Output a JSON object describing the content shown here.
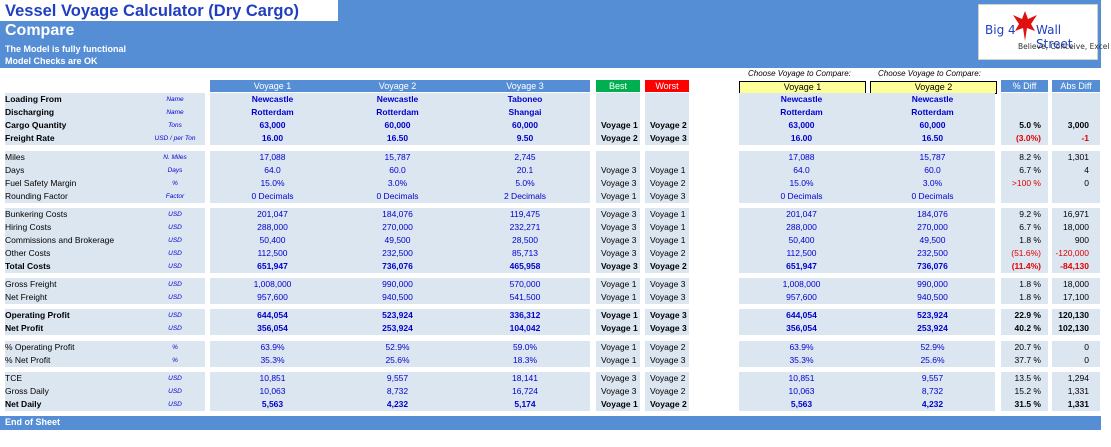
{
  "title": "Vessel Voyage Calculator (Dry Cargo)",
  "subtitle": "Compare",
  "status": [
    "The Model is fully functional",
    "Model Checks are OK"
  ],
  "logo": {
    "left": "Big 4",
    "right": "Wall Street",
    "tagline": "Believe, Conceive, Excel",
    "icon": "eagle-icon"
  },
  "footer": "End of Sheet",
  "colors": {
    "band": "#558ed5",
    "value_blue": "#0000cc",
    "row_shade": "#dce6f1",
    "best": "#00b050",
    "worst": "#ff0000",
    "negative": "#e00000",
    "select": "#ffff99"
  },
  "headers": {
    "voyages": [
      "Voyage 1",
      "Voyage 2",
      "Voyage 3"
    ],
    "best": "Best",
    "worst": "Worst",
    "choose": [
      "Choose Voyage to Compare:",
      "Choose Voyage to Compare:"
    ],
    "selected": [
      "Voyage 1",
      "Voyage 2"
    ],
    "pct_diff": "% Diff",
    "abs_diff": "Abs Diff"
  },
  "rows": [
    {
      "label": "Loading From",
      "bold": true,
      "unit": "Name",
      "v": [
        "Newcastle",
        "Newcastle",
        "Taboneo"
      ],
      "best": "",
      "worst": "",
      "c": [
        "Newcastle",
        "Newcastle"
      ],
      "pd": "",
      "ad": ""
    },
    {
      "label": "Discharging",
      "bold": true,
      "unit": "Name",
      "v": [
        "Rotterdam",
        "Rotterdam",
        "Shangai"
      ],
      "best": "",
      "worst": "",
      "c": [
        "Rotterdam",
        "Rotterdam"
      ],
      "pd": "",
      "ad": ""
    },
    {
      "label": "Cargo Quantity",
      "bold": true,
      "unit": "Tons",
      "v": [
        "63,000",
        "60,000",
        "60,000"
      ],
      "best": "Voyage 1",
      "worst": "Voyage 2",
      "c": [
        "63,000",
        "60,000"
      ],
      "pd": "5.0 %",
      "ad": "3,000"
    },
    {
      "label": "Freight Rate",
      "bold": true,
      "unit": "USD / per Ton",
      "v": [
        "16.00",
        "16.50",
        "9.50"
      ],
      "best": "Voyage 2",
      "worst": "Voyage 3",
      "c": [
        "16.00",
        "16.50"
      ],
      "pd": "(3.0%)",
      "ad": "-1",
      "neg": true
    },
    {
      "label": "Miles",
      "bold": false,
      "unit": "N. Miles",
      "v": [
        "17,088",
        "15,787",
        "2,745"
      ],
      "best": "",
      "worst": "",
      "c": [
        "17,088",
        "15,787"
      ],
      "pd": "8.2 %",
      "ad": "1,301"
    },
    {
      "label": "Days",
      "bold": false,
      "unit": "Days",
      "v": [
        "64.0",
        "60.0",
        "20.1"
      ],
      "best": "Voyage 3",
      "worst": "Voyage 1",
      "c": [
        "64.0",
        "60.0"
      ],
      "pd": "6.7 %",
      "ad": "4"
    },
    {
      "label": "Fuel Safety Margin",
      "bold": false,
      "unit": "%",
      "v": [
        "15.0%",
        "3.0%",
        "5.0%"
      ],
      "best": "Voyage 3",
      "worst": "Voyage 2",
      "c": [
        "15.0%",
        "3.0%"
      ],
      "pd": ">100 %",
      "ad": "0",
      "pdneg": true
    },
    {
      "label": "Rounding Factor",
      "bold": false,
      "unit": "Factor",
      "v": [
        "0 Decimals",
        "0 Decimals",
        "2 Decimals"
      ],
      "best": "Voyage 1",
      "worst": "Voyage 3",
      "c": [
        "0 Decimals",
        "0 Decimals"
      ],
      "pd": "",
      "ad": ""
    },
    {
      "label": "Bunkering Costs",
      "bold": false,
      "unit": "USD",
      "v": [
        "201,047",
        "184,076",
        "119,475"
      ],
      "best": "Voyage 3",
      "worst": "Voyage 1",
      "c": [
        "201,047",
        "184,076"
      ],
      "pd": "9.2 %",
      "ad": "16,971"
    },
    {
      "label": "Hiring Costs",
      "bold": false,
      "unit": "USD",
      "v": [
        "288,000",
        "270,000",
        "232,271"
      ],
      "best": "Voyage 3",
      "worst": "Voyage 1",
      "c": [
        "288,000",
        "270,000"
      ],
      "pd": "6.7 %",
      "ad": "18,000"
    },
    {
      "label": "Commissions and Brokerage",
      "bold": false,
      "unit": "USD",
      "v": [
        "50,400",
        "49,500",
        "28,500"
      ],
      "best": "Voyage 3",
      "worst": "Voyage 1",
      "c": [
        "50,400",
        "49,500"
      ],
      "pd": "1.8 %",
      "ad": "900"
    },
    {
      "label": "Other Costs",
      "bold": false,
      "unit": "USD",
      "v": [
        "112,500",
        "232,500",
        "85,713"
      ],
      "best": "Voyage 3",
      "worst": "Voyage 2",
      "c": [
        "112,500",
        "232,500"
      ],
      "pd": "(51.6%)",
      "ad": "-120,000",
      "neg": true
    },
    {
      "label": "Total Costs",
      "bold": true,
      "unit": "USD",
      "v": [
        "651,947",
        "736,076",
        "465,958"
      ],
      "best": "Voyage 3",
      "worst": "Voyage 2",
      "c": [
        "651,947",
        "736,076"
      ],
      "pd": "(11.4%)",
      "ad": "-84,130",
      "neg": true
    },
    {
      "label": "Gross Freight",
      "bold": false,
      "unit": "USD",
      "v": [
        "1,008,000",
        "990,000",
        "570,000"
      ],
      "best": "Voyage 1",
      "worst": "Voyage 3",
      "c": [
        "1,008,000",
        "990,000"
      ],
      "pd": "1.8 %",
      "ad": "18,000"
    },
    {
      "label": "Net Freight",
      "bold": false,
      "unit": "USD",
      "v": [
        "957,600",
        "940,500",
        "541,500"
      ],
      "best": "Voyage 1",
      "worst": "Voyage 3",
      "c": [
        "957,600",
        "940,500"
      ],
      "pd": "1.8 %",
      "ad": "17,100"
    },
    {
      "label": "Operating Profit",
      "bold": true,
      "unit": "USD",
      "v": [
        "644,054",
        "523,924",
        "336,312"
      ],
      "best": "Voyage 1",
      "worst": "Voyage 3",
      "c": [
        "644,054",
        "523,924"
      ],
      "pd": "22.9 %",
      "ad": "120,130"
    },
    {
      "label": "Net Profit",
      "bold": true,
      "unit": "USD",
      "v": [
        "356,054",
        "253,924",
        "104,042"
      ],
      "best": "Voyage 1",
      "worst": "Voyage 3",
      "c": [
        "356,054",
        "253,924"
      ],
      "pd": "40.2 %",
      "ad": "102,130"
    },
    {
      "label": "% Operating Profit",
      "bold": false,
      "unit": "%",
      "v": [
        "63.9%",
        "52.9%",
        "59.0%"
      ],
      "best": "Voyage 1",
      "worst": "Voyage 2",
      "c": [
        "63.9%",
        "52.9%"
      ],
      "pd": "20.7 %",
      "ad": "0"
    },
    {
      "label": "% Net Profit",
      "bold": false,
      "unit": "%",
      "v": [
        "35.3%",
        "25.6%",
        "18.3%"
      ],
      "best": "Voyage 1",
      "worst": "Voyage 3",
      "c": [
        "35.3%",
        "25.6%"
      ],
      "pd": "37.7 %",
      "ad": "0"
    },
    {
      "label": "TCE",
      "bold": false,
      "unit": "USD",
      "v": [
        "10,851",
        "9,557",
        "18,141"
      ],
      "best": "Voyage 3",
      "worst": "Voyage 2",
      "c": [
        "10,851",
        "9,557"
      ],
      "pd": "13.5 %",
      "ad": "1,294"
    },
    {
      "label": "Gross Daily",
      "bold": false,
      "unit": "USD",
      "v": [
        "10,063",
        "8,732",
        "16,724"
      ],
      "best": "Voyage 3",
      "worst": "Voyage 2",
      "c": [
        "10,063",
        "8,732"
      ],
      "pd": "15.2 %",
      "ad": "1,331"
    },
    {
      "label": "Net Daily",
      "bold": true,
      "unit": "USD",
      "v": [
        "5,563",
        "4,232",
        "5,174"
      ],
      "best": "Voyage 1",
      "worst": "Voyage 2",
      "c": [
        "5,563",
        "4,232"
      ],
      "pd": "31.5 %",
      "ad": "1,331"
    }
  ]
}
